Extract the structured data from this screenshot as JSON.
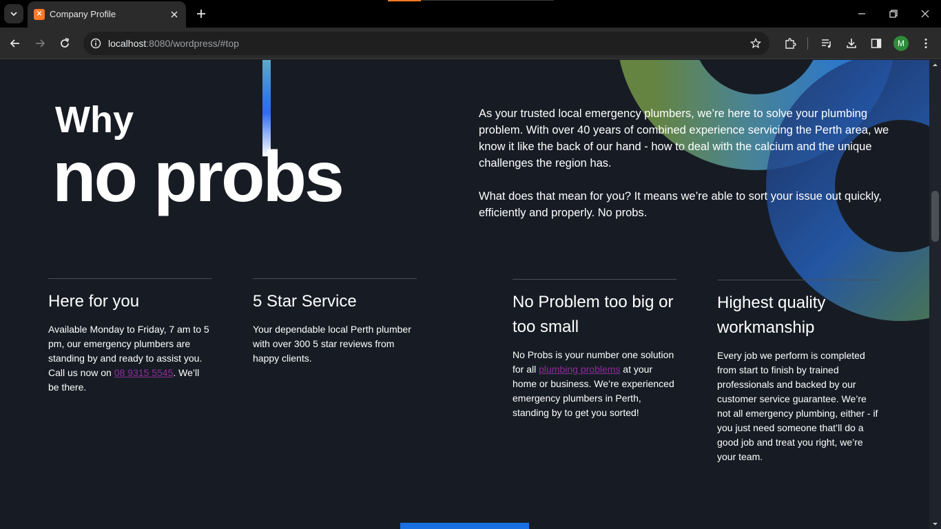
{
  "browser": {
    "tab_title": "Company Profile",
    "url_host": "localhost",
    "url_path": ":8080/wordpress/#top",
    "profile_initial": "M"
  },
  "hero": {
    "line1": "Why",
    "line2": "no probs"
  },
  "intro": {
    "p1": "As your trusted local emergency plumbers, we’re here to solve your plumbing problem. With over 40 years of combined experience servicing the Perth area, we know it like the back of our hand - how to deal with the calcium and the unique challenges the region has.",
    "p2": "What does that mean for you? It means we’re able to sort your issue out quickly, efficiently and properly. No probs."
  },
  "features": [
    {
      "title": "Here for you",
      "body_before": "Available Monday to Friday, 7 am to 5 pm, our emergency plumbers are standing by and ready to assist you. Call us now on ",
      "link": "08 9315 5545",
      "body_after": ". We’ll be there."
    },
    {
      "title": "5 Star Service",
      "body": "Your dependable local Perth plumber with over 300 5 star reviews from happy clients."
    },
    {
      "title": "No Problem too big or too small",
      "body_before": "No Probs is your number one solution for all ",
      "link": "plumbing problems",
      "body_after": " at your home or business. We’re experienced emergency plumbers in Perth, standing by to get you sorted!"
    },
    {
      "title": "Highest quality workmanship",
      "body": "Every job we perform is completed from start to finish by trained professionals and backed by our customer service guarantee. We’re not all emergency plumbing, either - if you just need someone that’ll do a good job and treat you right, we’re your team."
    }
  ],
  "colors": {
    "page_bg": "#171c24",
    "accent_blue": "#1a6fe3",
    "link_purple": "#8a2f98",
    "favicon_orange": "#fb7a24"
  }
}
